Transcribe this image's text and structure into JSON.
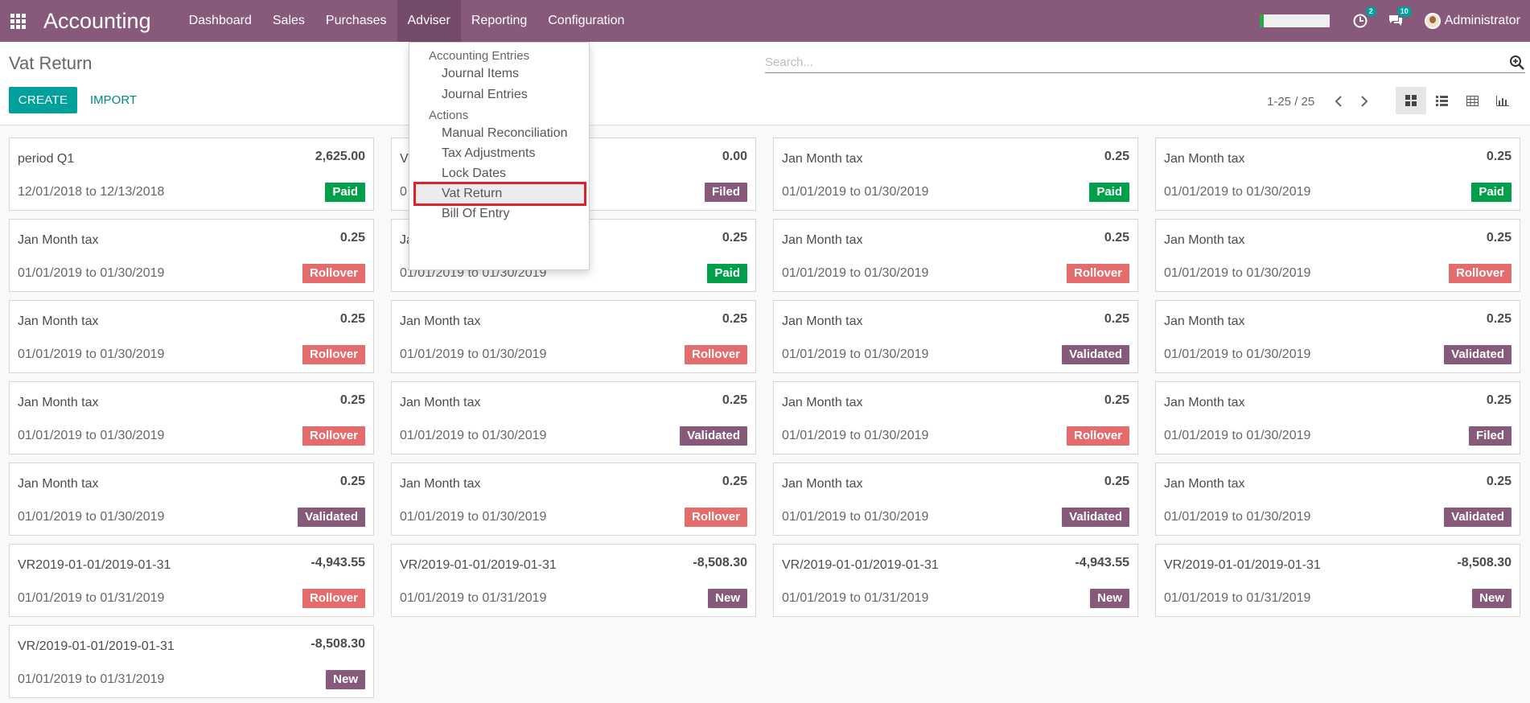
{
  "navbar": {
    "app_title": "Accounting",
    "menu": [
      "Dashboard",
      "Sales",
      "Purchases",
      "Adviser",
      "Reporting",
      "Configuration"
    ],
    "active_menu": "Adviser",
    "activity_badge": "2",
    "message_badge": "10",
    "user_name": "Administrator",
    "progress_fraction": 0.06,
    "progress_color": "#28a745",
    "brand_color": "#875a7b"
  },
  "control_panel": {
    "breadcrumb": "Vat Return",
    "create_label": "CREATE",
    "import_label": "IMPORT",
    "search_placeholder": "Search...",
    "pager_text": "1-25 / 25",
    "views": [
      "kanban-icon",
      "list-icon",
      "grid-icon",
      "graph-icon"
    ],
    "active_view": "kanban-icon"
  },
  "dropdown": {
    "sections": [
      {
        "header": "Accounting Entries",
        "items": [
          "Journal Items",
          "Journal Entries"
        ]
      },
      {
        "header": "Actions",
        "items": [
          "Manual Reconciliation",
          "Tax Adjustments",
          "Lock Dates",
          "Vat Return",
          "Bill Of Entry"
        ]
      }
    ],
    "highlighted": "Vat Return"
  },
  "status_colors": {
    "Paid": "#00a04a",
    "Filed": "#875a7b",
    "Rollover": "#e46c6c",
    "Validated": "#875a7b",
    "New": "#875a7b"
  },
  "cards": [
    {
      "name": "period Q1",
      "amount": "2,625.00",
      "period": "12/01/2018 to 12/13/2018",
      "status": "Paid"
    },
    {
      "name": "V",
      "amount": "0.00",
      "period": "0",
      "status": "Filed"
    },
    {
      "name": "Jan Month tax",
      "amount": "0.25",
      "period": "01/01/2019 to 01/30/2019",
      "status": "Paid"
    },
    {
      "name": "Jan Month tax",
      "amount": "0.25",
      "period": "01/01/2019 to 01/30/2019",
      "status": "Paid"
    },
    {
      "name": "Jan Month tax",
      "amount": "0.25",
      "period": "01/01/2019 to 01/30/2019",
      "status": "Rollover"
    },
    {
      "name": "Ja",
      "amount": "0.25",
      "period": "01/01/2019 to 01/30/2019",
      "status": "Paid"
    },
    {
      "name": "Jan Month tax",
      "amount": "0.25",
      "period": "01/01/2019 to 01/30/2019",
      "status": "Rollover"
    },
    {
      "name": "Jan Month tax",
      "amount": "0.25",
      "period": "01/01/2019 to 01/30/2019",
      "status": "Rollover"
    },
    {
      "name": "Jan Month tax",
      "amount": "0.25",
      "period": "01/01/2019 to 01/30/2019",
      "status": "Rollover"
    },
    {
      "name": "Jan Month tax",
      "amount": "0.25",
      "period": "01/01/2019 to 01/30/2019",
      "status": "Rollover"
    },
    {
      "name": "Jan Month tax",
      "amount": "0.25",
      "period": "01/01/2019 to 01/30/2019",
      "status": "Validated"
    },
    {
      "name": "Jan Month tax",
      "amount": "0.25",
      "period": "01/01/2019 to 01/30/2019",
      "status": "Validated"
    },
    {
      "name": "Jan Month tax",
      "amount": "0.25",
      "period": "01/01/2019 to 01/30/2019",
      "status": "Rollover"
    },
    {
      "name": "Jan Month tax",
      "amount": "0.25",
      "period": "01/01/2019 to 01/30/2019",
      "status": "Validated"
    },
    {
      "name": "Jan Month tax",
      "amount": "0.25",
      "period": "01/01/2019 to 01/30/2019",
      "status": "Rollover"
    },
    {
      "name": "Jan Month tax",
      "amount": "0.25",
      "period": "01/01/2019 to 01/30/2019",
      "status": "Filed"
    },
    {
      "name": "Jan Month tax",
      "amount": "0.25",
      "period": "01/01/2019 to 01/30/2019",
      "status": "Validated"
    },
    {
      "name": "Jan Month tax",
      "amount": "0.25",
      "period": "01/01/2019 to 01/30/2019",
      "status": "Rollover"
    },
    {
      "name": "Jan Month tax",
      "amount": "0.25",
      "period": "01/01/2019 to 01/30/2019",
      "status": "Validated"
    },
    {
      "name": "Jan Month tax",
      "amount": "0.25",
      "period": "01/01/2019 to 01/30/2019",
      "status": "Validated"
    },
    {
      "name": "VR2019-01-01/2019-01-31",
      "amount": "-4,943.55",
      "period": "01/01/2019 to 01/31/2019",
      "status": "Rollover"
    },
    {
      "name": "VR/2019-01-01/2019-01-31",
      "amount": "-8,508.30",
      "period": "01/01/2019 to 01/31/2019",
      "status": "New"
    },
    {
      "name": "VR/2019-01-01/2019-01-31",
      "amount": "-4,943.55",
      "period": "01/01/2019 to 01/31/2019",
      "status": "New"
    },
    {
      "name": "VR/2019-01-01/2019-01-31",
      "amount": "-8,508.30",
      "period": "01/01/2019 to 01/31/2019",
      "status": "New"
    },
    {
      "name": "VR/2019-01-01/2019-01-31",
      "amount": "-8,508.30",
      "period": "01/01/2019 to 01/31/2019",
      "status": "New"
    }
  ]
}
